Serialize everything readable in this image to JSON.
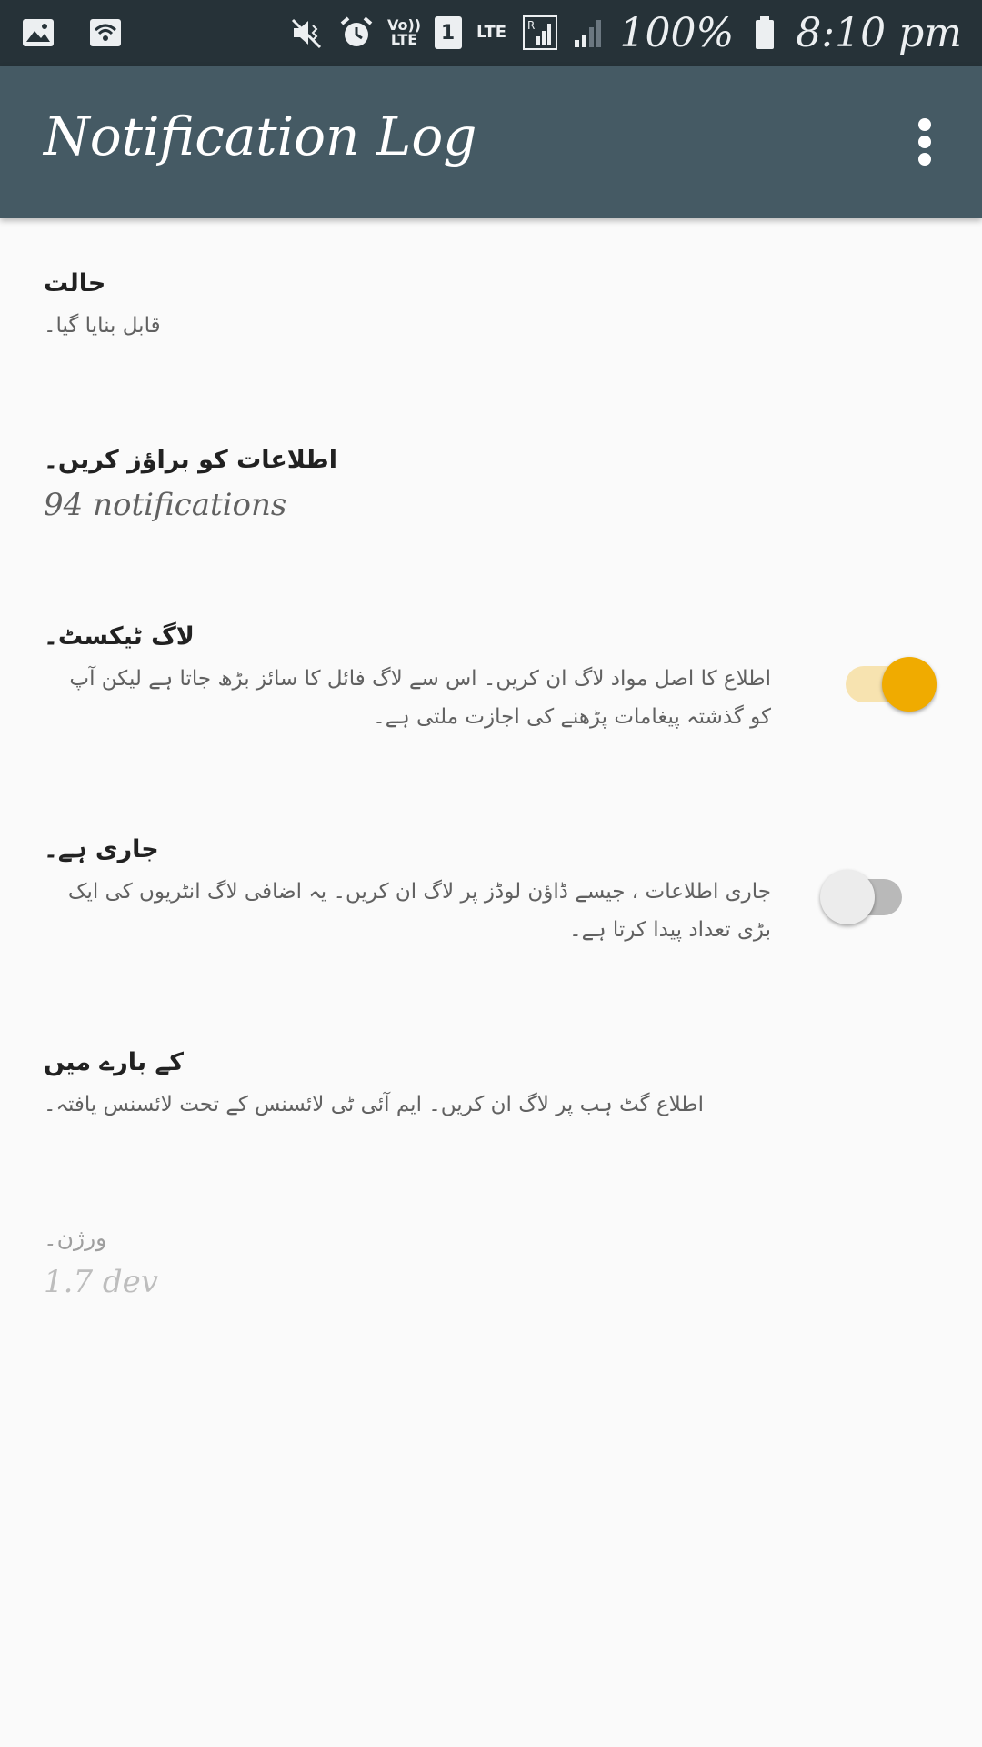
{
  "status_bar": {
    "left_icons": [
      "image-icon",
      "wifi-icon"
    ],
    "volte_label": "Vo)) LTE",
    "sim_slot": "1",
    "lte_label": "LTE",
    "battery_percent": "100%",
    "time": "8:10 pm"
  },
  "toolbar": {
    "title": "Notification Log",
    "menu_icon": "more-vert-icon"
  },
  "preferences": {
    "status": {
      "title": "حالت",
      "summary": "قابل بنایا گیا۔"
    },
    "browse": {
      "title": "اطلاعات کو براؤز کریں۔",
      "summary": "94 notifications"
    },
    "log_text": {
      "title": "لاگ ٹیکسٹ۔",
      "summary": "اطلاع کا اصل مواد لاگ ان کریں۔ اس سے لاگ فائل کا سائز بڑھ جاتا ہے لیکن آپ کو گذشتہ پیغامات پڑھنے کی اجازت ملتی ہے۔",
      "enabled": true
    },
    "ongoing": {
      "title": "جاری ہے۔",
      "summary": "جاری اطلاعات ، جیسے ڈاؤن لوڈز پر لاگ ان کریں۔ یہ اضافی لاگ انٹریوں کی ایک بڑی تعداد پیدا کرتا ہے۔",
      "enabled": false
    },
    "about": {
      "title": "کے بارے میں",
      "summary": "اطلاع گٹ ہب پر لاگ ان کریں۔ ایم آئی ٹی لائسنس کے تحت لائسنس یافتہ۔"
    },
    "version": {
      "title": "ورژن۔",
      "summary": "1.7 dev"
    }
  },
  "colors": {
    "status_bar": "#263238",
    "toolbar": "#455a64",
    "accent": "#f0ab00",
    "background": "#fafafa"
  }
}
